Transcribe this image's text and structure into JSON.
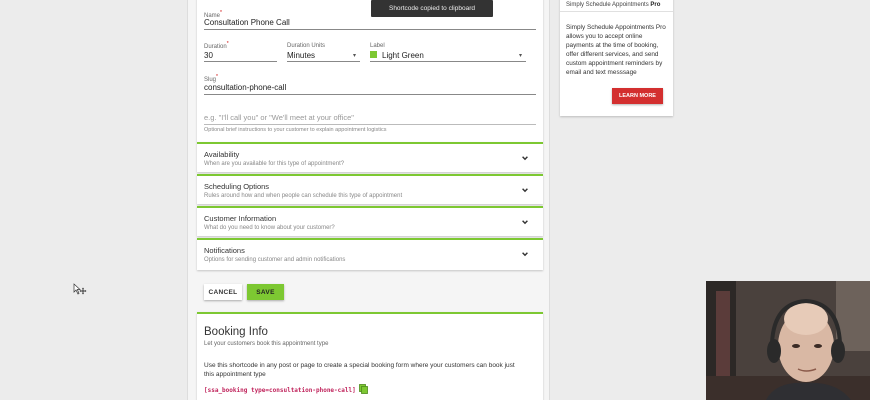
{
  "toast": "Shortcode copied to clipboard",
  "form": {
    "name_label": "Name",
    "name_value": "Consultation Phone Call",
    "duration_label": "Duration",
    "duration_value": "30",
    "units_label": "Duration Units",
    "units_value": "Minutes",
    "label_label": "Label",
    "label_value": "Light Green",
    "label_color": "#7dc832",
    "slug_label": "Slug",
    "slug_value": "consultation-phone-call",
    "instructions_placeholder": "e.g. \"I'll call you\" or \"We'll meet at your office\"",
    "instructions_hint": "Optional brief instructions to your customer to explain appointment logistics",
    "required_mark": "*"
  },
  "accordions": [
    {
      "title": "Availability",
      "subtitle": "When are you available for this type of appointment?"
    },
    {
      "title": "Scheduling Options",
      "subtitle": "Rules around how and when people can schedule this type of appointment"
    },
    {
      "title": "Customer Information",
      "subtitle": "What do you need to know about your customer?"
    },
    {
      "title": "Notifications",
      "subtitle": "Options for sending customer and admin notifications"
    }
  ],
  "actions": {
    "cancel_label": "CANCEL",
    "save_label": "SAVE"
  },
  "booking": {
    "title": "Booking Info",
    "subtitle": "Let your customers book this appointment type",
    "description": "Use this shortcode in any post or page to create a special booking form where your customers can book just this appointment type",
    "shortcode": "[ssa_booking type=consultation-phone-call]"
  },
  "promo": {
    "heading_prefix": "Simply Schedule Appointments",
    "heading_bold": "Pro",
    "body": "Simply Schedule Appointments Pro allows you to accept online payments at the time of booking, offer different services, and send custom appointment reminders by email and text messsage",
    "button_label": "LEARN MORE"
  },
  "colors": {
    "accent_green": "#7dc832",
    "promo_red": "#d32f2f",
    "shortcode_pink": "#c0245c"
  }
}
